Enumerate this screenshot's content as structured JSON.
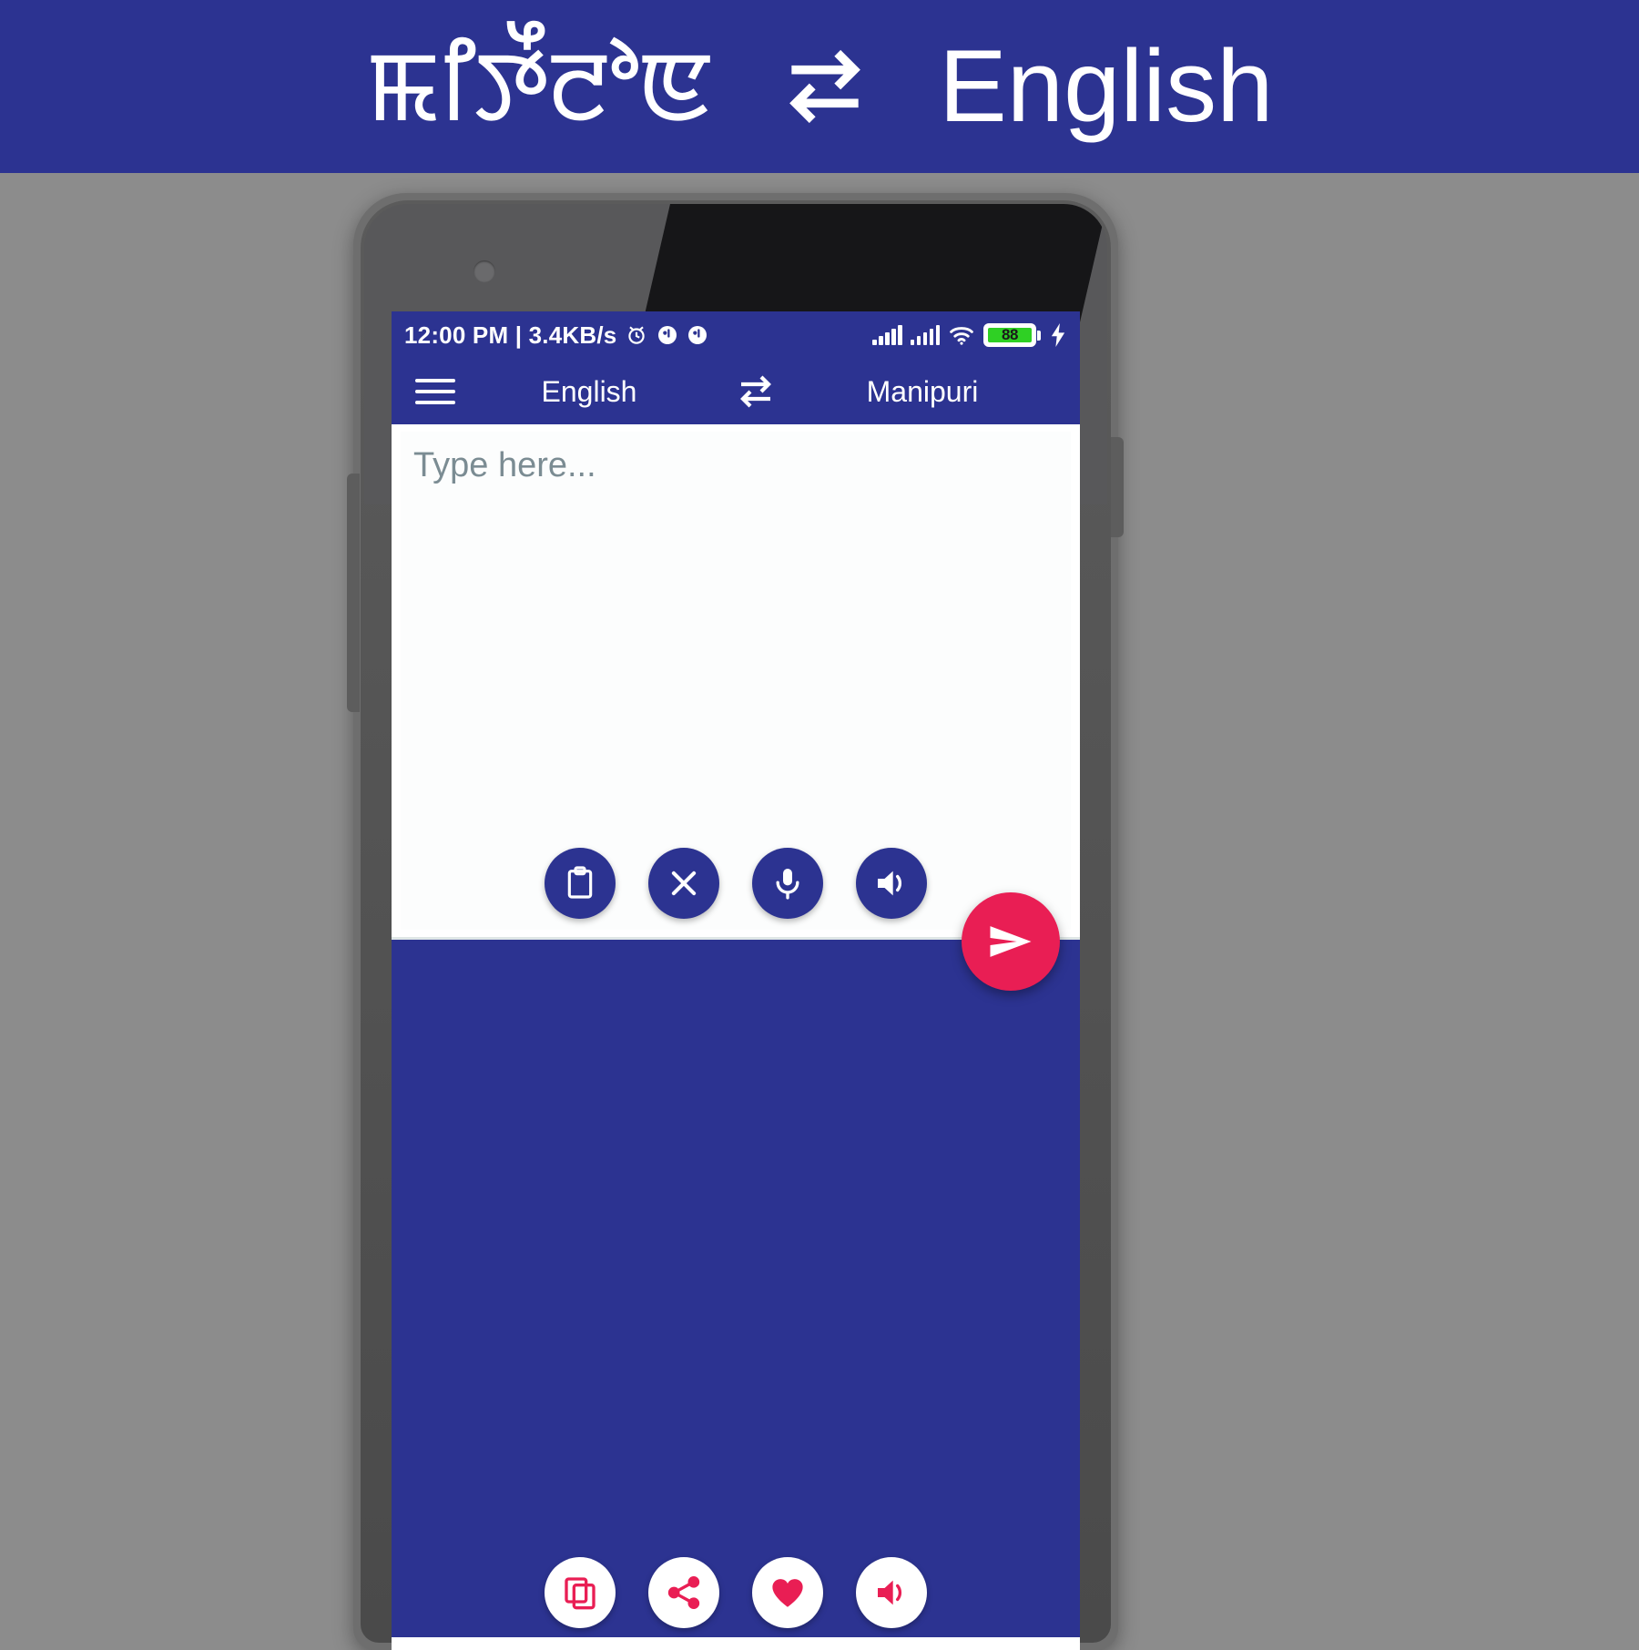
{
  "banner": {
    "source_language": "ꯃꯤꯇꯩꯂꯣꯟ",
    "target_language": "English",
    "swap_icon": "swap-arrows-icon",
    "background_color": "#2c3391",
    "text_color": "#ffffff"
  },
  "phone": {
    "statusbar": {
      "time_and_speed": "12:00 PM | 3.4KB/s",
      "alarm_icon": "alarm-clock-icon",
      "notification_icon_1": "notification-badge-icon",
      "notification_icon_2": "notification-badge-icon",
      "signal_1_icon": "cell-signal-icon",
      "signal_2_icon": "cell-signal-icon",
      "wifi_icon": "wifi-icon",
      "battery_level": "88",
      "battery_fill_color": "#2fd024",
      "charging_icon": "lightning-bolt-icon",
      "background_color": "#2c3391"
    },
    "toolbar": {
      "menu_icon": "hamburger-menu-icon",
      "source_language": "English",
      "swap_icon": "swap-arrows-icon",
      "target_language": "Manipuri"
    },
    "source_panel": {
      "placeholder": "Type here...",
      "value": "",
      "actions": [
        {
          "name": "paste-button",
          "icon": "clipboard-icon",
          "style": "blue"
        },
        {
          "name": "clear-button",
          "icon": "close-x-icon",
          "style": "blue"
        },
        {
          "name": "voice-input-button",
          "icon": "microphone-icon",
          "style": "blue"
        },
        {
          "name": "speak-source-button",
          "icon": "speaker-icon",
          "style": "blue"
        }
      ]
    },
    "send_button": {
      "icon": "send-paper-plane-icon",
      "color": "#e91e54"
    },
    "target_panel": {
      "value": "",
      "background_color": "#2c3391",
      "actions": [
        {
          "name": "copy-button",
          "icon": "copy-icon",
          "style": "white"
        },
        {
          "name": "share-button",
          "icon": "share-icon",
          "style": "white"
        },
        {
          "name": "favorite-button",
          "icon": "heart-icon",
          "style": "white"
        },
        {
          "name": "speak-target-button",
          "icon": "speaker-icon",
          "style": "white"
        }
      ],
      "icon_color": "#e91e54"
    }
  }
}
